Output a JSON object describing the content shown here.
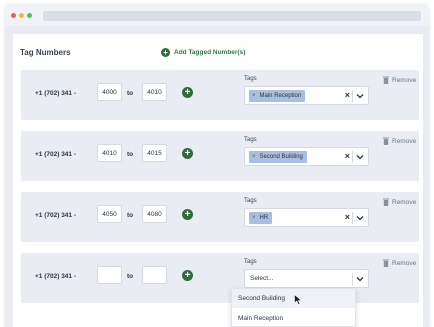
{
  "section": {
    "title": "Tag Numbers",
    "add_label": "Add Tagged Number(s)"
  },
  "rows": [
    {
      "prefix": "+1 (702) 341 -",
      "from": "4000",
      "to": "4010",
      "to_label": "to",
      "tags_label": "Tags",
      "tag": "Main Reception",
      "remove_label": "Remove"
    },
    {
      "prefix": "+1 (702) 341 -",
      "from": "4010",
      "to": "4015",
      "to_label": "to",
      "tags_label": "Tags",
      "tag": "Second Building",
      "remove_label": "Remove"
    },
    {
      "prefix": "+1 (702) 341 -",
      "from": "4050",
      "to": "4080",
      "to_label": "to",
      "tags_label": "Tags",
      "tag": "HR",
      "remove_label": "Remove"
    },
    {
      "prefix": "+1 (702) 341 -",
      "from": "",
      "to": "",
      "to_label": "to",
      "tags_label": "Tags",
      "placeholder": "Select...",
      "remove_label": "Remove"
    }
  ],
  "dropdown": {
    "options": [
      "Second Building",
      "Main Reception"
    ],
    "hovered": "Second Building"
  },
  "colors": {
    "accent_green": "#2e6b3d",
    "chip_blue": "#a9bfe0",
    "row_bg": "#e9edf3"
  }
}
